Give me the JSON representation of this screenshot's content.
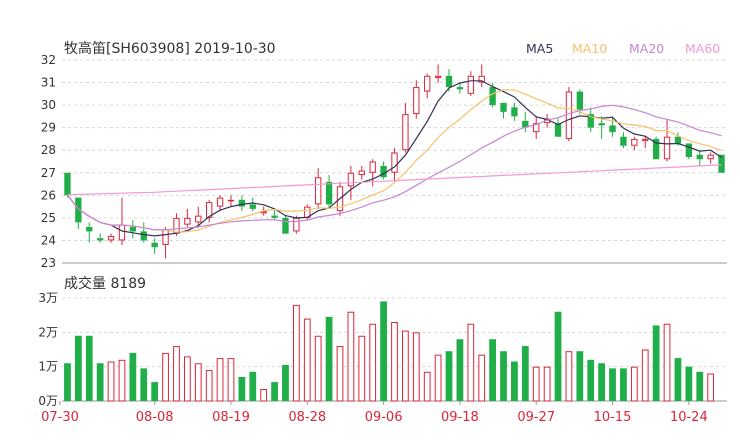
{
  "chart_data": [
    {
      "type": "candlestick",
      "title": "牧高笛[SH603908] 2019-10-30",
      "x": [
        "07-30",
        "08-08",
        "08-19",
        "08-28",
        "09-06",
        "09-18",
        "09-27",
        "10-15",
        "10-24"
      ],
      "ylim": [
        23,
        32
      ],
      "yticks": [
        "23",
        "24",
        "25",
        "26",
        "27",
        "28",
        "29",
        "30",
        "31",
        "32"
      ],
      "legend": [
        {
          "name": "MA5",
          "color": "#333355"
        },
        {
          "name": "MA10",
          "color": "#f5c26b"
        },
        {
          "name": "MA20",
          "color": "#c785d6"
        },
        {
          "name": "MA60",
          "color": "#f29ad1"
        }
      ],
      "up_color": "#d9263b",
      "down_color": "#1fae48",
      "ohlc": [
        [
          27.0,
          27.0,
          25.9,
          26.0
        ],
        [
          25.9,
          25.9,
          24.5,
          24.8
        ],
        [
          24.6,
          24.8,
          23.9,
          24.4
        ],
        [
          24.1,
          24.3,
          23.9,
          24.0
        ],
        [
          24.0,
          24.3,
          23.9,
          24.2
        ],
        [
          24.0,
          25.9,
          23.8,
          24.7
        ],
        [
          24.6,
          24.9,
          24.1,
          24.4
        ],
        [
          24.4,
          24.8,
          23.9,
          24.0
        ],
        [
          23.9,
          24.1,
          23.4,
          23.7
        ],
        [
          23.8,
          24.6,
          23.2,
          24.5
        ],
        [
          24.3,
          25.2,
          24.2,
          25.0
        ],
        [
          24.7,
          25.4,
          24.6,
          25.0
        ],
        [
          24.8,
          25.5,
          24.6,
          25.1
        ],
        [
          25.0,
          25.8,
          24.8,
          25.7
        ],
        [
          25.5,
          26.0,
          25.3,
          25.9
        ],
        [
          25.8,
          26.0,
          25.5,
          25.8
        ],
        [
          25.8,
          26.0,
          25.3,
          25.5
        ],
        [
          25.6,
          25.9,
          25.3,
          25.4
        ],
        [
          25.2,
          25.5,
          25.1,
          25.3
        ],
        [
          25.1,
          25.4,
          24.9,
          25.0
        ],
        [
          25.0,
          25.1,
          24.3,
          24.3
        ],
        [
          24.4,
          25.1,
          24.3,
          25.0
        ],
        [
          25.0,
          25.6,
          24.9,
          25.5
        ],
        [
          25.6,
          27.2,
          25.4,
          26.8
        ],
        [
          26.6,
          26.9,
          25.4,
          25.6
        ],
        [
          25.3,
          26.6,
          25.1,
          26.4
        ],
        [
          26.4,
          27.3,
          25.8,
          27.0
        ],
        [
          26.9,
          27.3,
          26.7,
          27.1
        ],
        [
          27.0,
          27.6,
          26.4,
          27.5
        ],
        [
          27.3,
          27.5,
          26.7,
          26.8
        ],
        [
          27.0,
          28.1,
          26.6,
          27.9
        ],
        [
          28.0,
          30.1,
          27.9,
          29.6
        ],
        [
          29.6,
          31.1,
          29.4,
          30.8
        ],
        [
          30.6,
          31.4,
          30.3,
          31.3
        ],
        [
          31.2,
          31.8,
          31.0,
          31.3
        ],
        [
          31.3,
          31.6,
          30.6,
          30.8
        ],
        [
          30.8,
          31.0,
          30.5,
          30.7
        ],
        [
          30.5,
          31.5,
          30.4,
          31.3
        ],
        [
          31.0,
          31.8,
          30.8,
          31.3
        ],
        [
          30.8,
          31.0,
          29.9,
          30.0
        ],
        [
          30.1,
          30.1,
          29.4,
          29.7
        ],
        [
          29.9,
          30.1,
          29.3,
          29.5
        ],
        [
          29.3,
          29.7,
          28.8,
          29.0
        ],
        [
          28.8,
          29.5,
          28.5,
          29.2
        ],
        [
          29.2,
          29.6,
          29.0,
          29.4
        ],
        [
          29.2,
          29.4,
          28.7,
          28.6
        ],
        [
          28.5,
          30.8,
          28.4,
          30.6
        ],
        [
          30.6,
          30.7,
          29.6,
          29.8
        ],
        [
          29.6,
          29.9,
          28.8,
          29.0
        ],
        [
          29.2,
          29.5,
          28.5,
          29.1
        ],
        [
          29.1,
          29.5,
          28.6,
          28.8
        ],
        [
          28.6,
          28.8,
          28.1,
          28.2
        ],
        [
          28.2,
          28.6,
          28.0,
          28.5
        ],
        [
          28.4,
          28.6,
          28.1,
          28.5
        ],
        [
          28.5,
          28.6,
          27.7,
          27.6
        ],
        [
          27.6,
          29.4,
          27.5,
          28.6
        ],
        [
          28.6,
          28.8,
          28.2,
          28.3
        ],
        [
          28.3,
          28.3,
          27.6,
          27.7
        ],
        [
          27.8,
          28.0,
          27.3,
          27.6
        ],
        [
          27.6,
          27.9,
          27.4,
          27.8
        ],
        [
          27.8,
          27.8,
          27.0,
          27.0
        ]
      ]
    },
    {
      "type": "bar",
      "title": "成交量 8189",
      "ylim": [
        0,
        3
      ],
      "yticks": [
        "0万",
        "1万",
        "2万",
        "3万"
      ],
      "values": [
        1.1,
        1.9,
        1.9,
        1.1,
        1.15,
        1.2,
        1.4,
        0.95,
        0.55,
        1.4,
        1.6,
        1.3,
        1.1,
        0.9,
        1.25,
        1.25,
        0.7,
        0.85,
        0.35,
        0.55,
        1.05,
        2.8,
        2.4,
        1.9,
        2.45,
        1.6,
        2.6,
        1.9,
        2.25,
        2.9,
        2.3,
        2.05,
        2.0,
        0.85,
        1.35,
        1.45,
        1.8,
        2.25,
        1.35,
        1.8,
        1.45,
        1.15,
        1.6,
        1.0,
        1.0,
        2.6,
        1.45,
        1.45,
        1.2,
        1.1,
        0.95,
        0.95,
        1.0,
        1.5,
        2.2,
        2.25,
        1.25,
        1.0,
        0.85,
        0.8
      ]
    }
  ]
}
